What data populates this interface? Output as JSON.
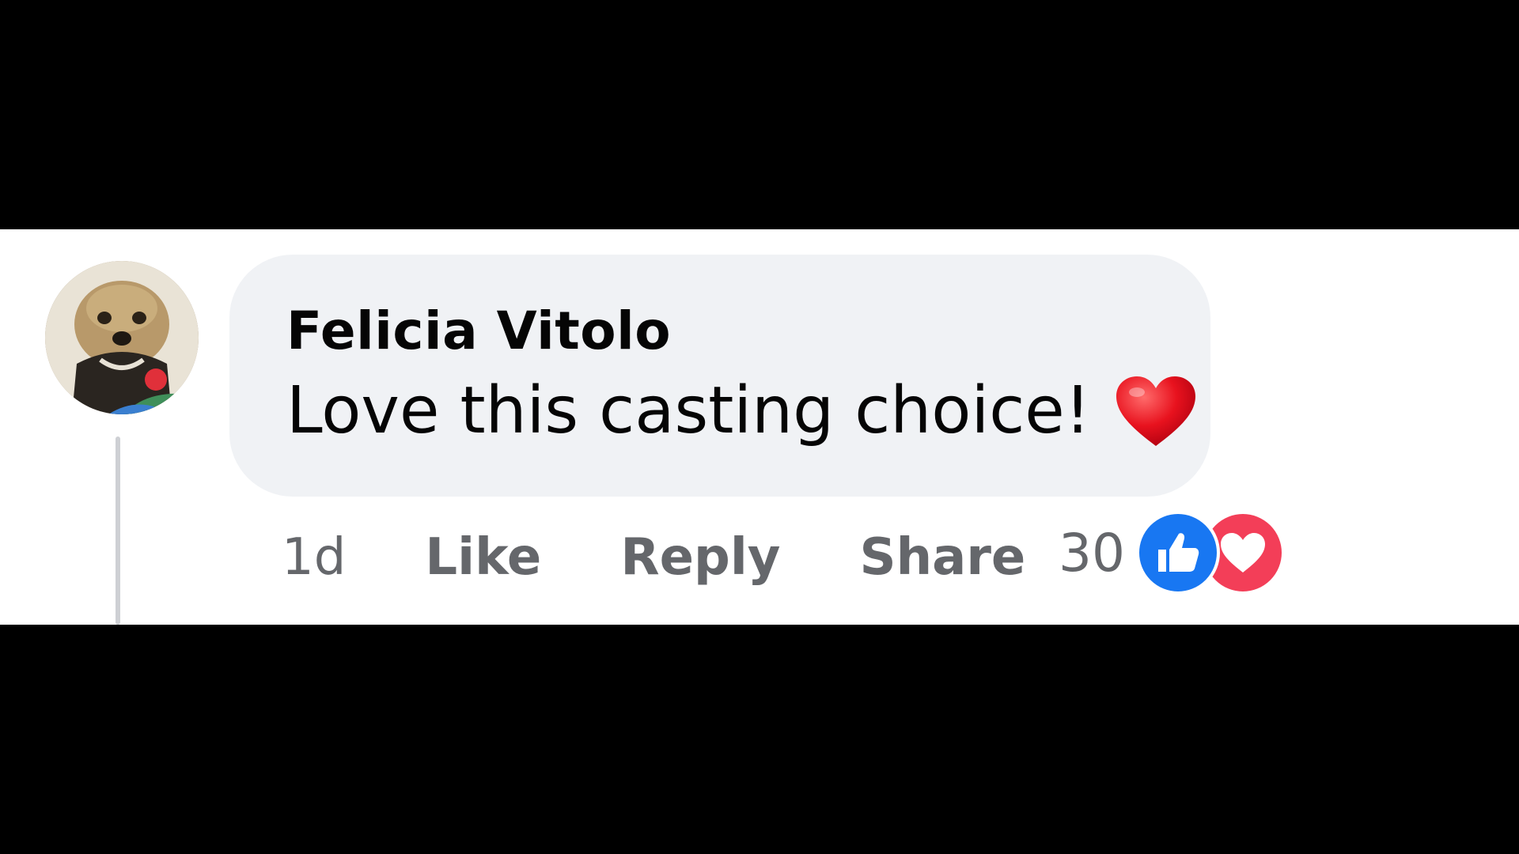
{
  "comment": {
    "author": "Felicia Vitolo",
    "text": "Love this casting choice!",
    "text_emoji": "heart-emoji",
    "timestamp": "1d",
    "actions": {
      "like": "Like",
      "reply": "Reply",
      "share": "Share"
    },
    "reactions": {
      "count": "30",
      "types": [
        "like-icon",
        "love-icon"
      ]
    }
  },
  "colors": {
    "bubble": "#f0f2f5",
    "author_text": "#050505",
    "action_text": "#65676b",
    "like_blue": "#1877f2",
    "love_red": "#f33e58",
    "thread_line": "#ced0d4"
  }
}
